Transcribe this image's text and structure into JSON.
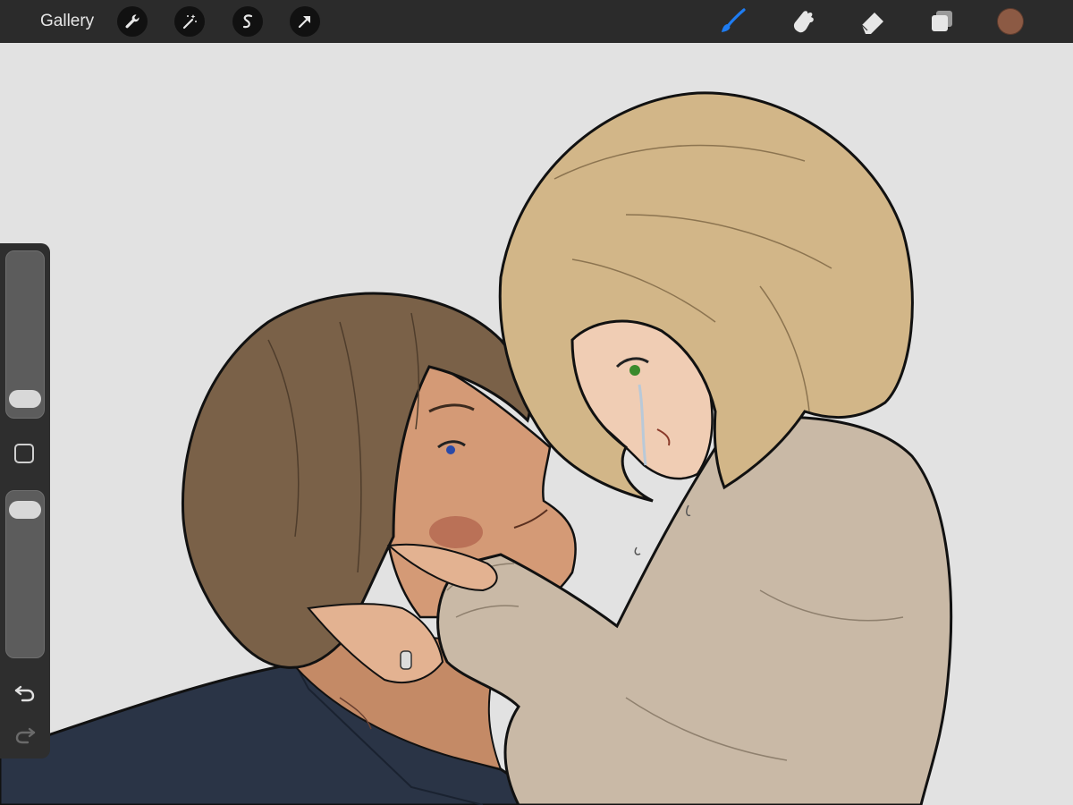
{
  "toolbar": {
    "gallery_label": "Gallery",
    "left_tools": [
      "wrench-icon",
      "magic-wand-icon",
      "selection-s-icon",
      "transform-arrow-icon"
    ],
    "right_tools": [
      "brush-icon",
      "smudge-icon",
      "eraser-icon",
      "layers-icon"
    ],
    "active_tool": "brush-icon",
    "current_color": "#8c5a44",
    "accent_color": "#1e7cf2"
  },
  "sidebar": {
    "brush_size_level": 0.05,
    "opacity_level": 0.95,
    "icons": [
      "modify-square-icon",
      "undo-icon",
      "redo-icon"
    ]
  }
}
